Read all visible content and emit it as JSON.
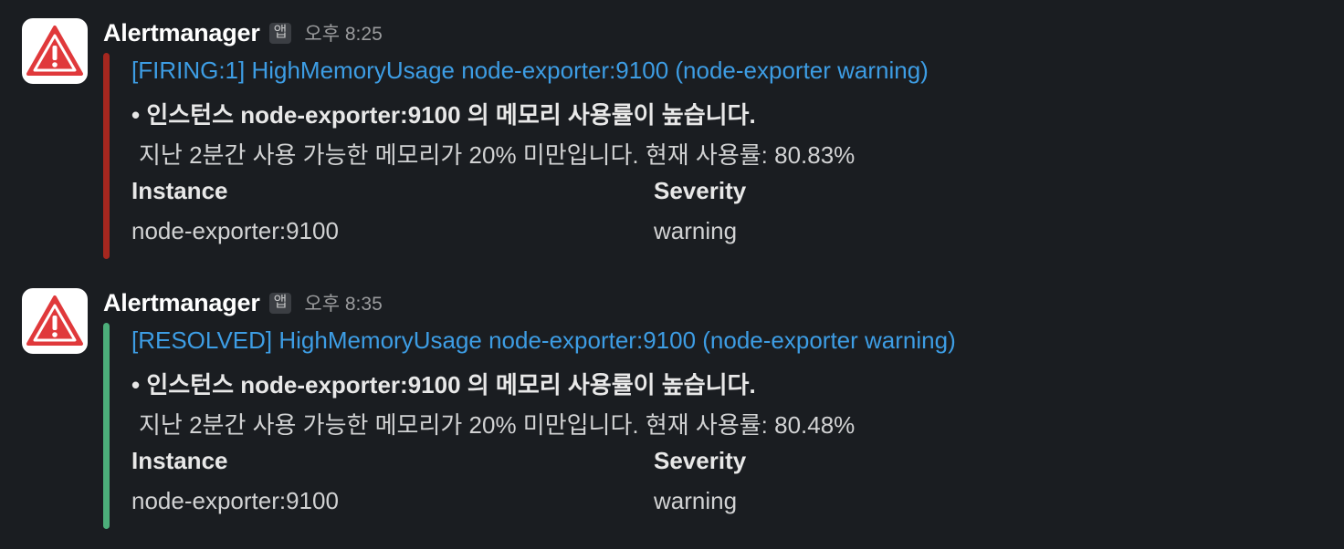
{
  "messages": [
    {
      "sender": "Alertmanager",
      "app_badge": "앱",
      "timestamp": "오후 8:25",
      "avatar_icon": "warning-triangle-icon",
      "bar_color": "#a5271f",
      "title": "[FIRING:1] HighMemoryUsage node-exporter:9100 (node-exporter warning)",
      "summary": "• 인스턴스 node-exporter:9100 의 메모리 사용률이 높습니다.",
      "description": "지난 2분간 사용 가능한 메모리가 20% 미만입니다. 현재 사용률: 80.83%",
      "fields": [
        {
          "title": "Instance",
          "value": "node-exporter:9100"
        },
        {
          "title": "Severity",
          "value": "warning"
        }
      ]
    },
    {
      "sender": "Alertmanager",
      "app_badge": "앱",
      "timestamp": "오후 8:35",
      "avatar_icon": "warning-triangle-icon",
      "bar_color": "#4cae7a",
      "title": "[RESOLVED] HighMemoryUsage node-exporter:9100 (node-exporter warning)",
      "summary": "• 인스턴스 node-exporter:9100 의 메모리 사용률이 높습니다.",
      "description": "지난 2분간 사용 가능한 메모리가 20% 미만입니다. 현재 사용률: 80.48%",
      "fields": [
        {
          "title": "Instance",
          "value": "node-exporter:9100"
        },
        {
          "title": "Severity",
          "value": "warning"
        }
      ]
    }
  ],
  "colors": {
    "background": "#1a1d21",
    "link": "#3d9de4",
    "avatar_icon": "#e0393b"
  }
}
